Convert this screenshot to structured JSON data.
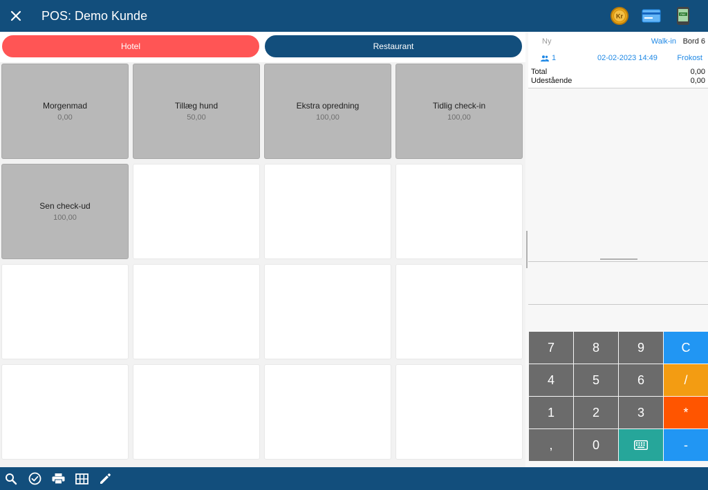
{
  "header": {
    "close_icon": "close-icon",
    "title": "POS: Demo Kunde",
    "icons": [
      "coin-kr-icon",
      "credit-card-icon",
      "mobile-pay-icon"
    ]
  },
  "tabs": [
    {
      "label": "Hotel",
      "active": true
    },
    {
      "label": "Restaurant",
      "active": false
    }
  ],
  "products": [
    {
      "name": "Morgenmad",
      "price": "0,00"
    },
    {
      "name": "Tillæg hund",
      "price": "50,00"
    },
    {
      "name": "Ekstra opredning",
      "price": "100,00"
    },
    {
      "name": "Tidlig check-in",
      "price": "100,00"
    },
    {
      "name": "Sen check-ud",
      "price": "100,00"
    }
  ],
  "order": {
    "status": "Ny",
    "customer_type": "Walk-in",
    "table": "Bord 6",
    "guests": "1",
    "datetime": "02-02-2023 14:49",
    "meal": "Frokost",
    "total_label": "Total",
    "total_value": "0,00",
    "outstanding_label": "Udestående",
    "outstanding_value": "0,00"
  },
  "keypad": [
    "7",
    "8",
    "9",
    "C",
    "4",
    "5",
    "6",
    "/",
    "1",
    "2",
    "3",
    "*",
    ",",
    "0",
    "keyboard-icon",
    "-"
  ],
  "bottom_icons": [
    "search-icon",
    "check-circle-icon",
    "print-icon",
    "grid-icon",
    "edit-icon"
  ],
  "colors": {
    "header": "#124e7c",
    "active_tab": "#ff5555",
    "accent_blue": "#2196f3",
    "orange": "#f39c12",
    "red_orange": "#ff5500",
    "teal": "#26a69a"
  }
}
